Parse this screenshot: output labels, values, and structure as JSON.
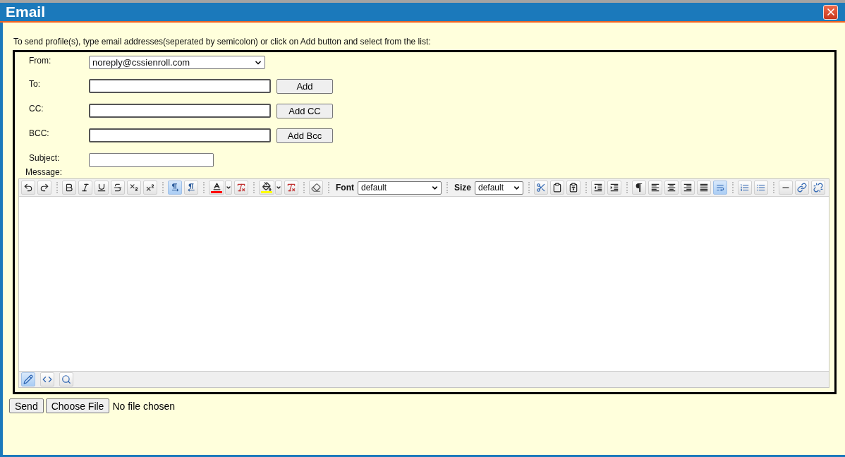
{
  "window": {
    "title": "Email"
  },
  "instructions": "To send profile(s), type email addresses(seperated by semicolon) or click on Add button and select from the list:",
  "form": {
    "from": {
      "label": "From:",
      "value": "noreply@cssienroll.com"
    },
    "recipients": [
      {
        "label": "To:",
        "button": "Add"
      },
      {
        "label": "CC:",
        "button": "Add CC"
      },
      {
        "label": "BCC:",
        "button": "Add Bcc"
      }
    ],
    "subject": {
      "label": "Subject:"
    },
    "message": {
      "label": "Message:"
    }
  },
  "editor": {
    "toolbar": [
      {
        "items": [
          {
            "kind": "button",
            "selected": false
          },
          {
            "kind": "button",
            "selected": false
          }
        ]
      },
      {
        "items": [
          {
            "kind": "button",
            "selected": false
          },
          {
            "kind": "button",
            "selected": false
          },
          {
            "kind": "button",
            "selected": false
          },
          {
            "kind": "button",
            "selected": false
          },
          {
            "kind": "button",
            "selected": false
          },
          {
            "kind": "button",
            "selected": false
          }
        ]
      },
      {
        "items": [
          {
            "kind": "button",
            "selected": true
          },
          {
            "kind": "button",
            "selected": false
          }
        ]
      },
      {
        "items": [
          {
            "kind": "color",
            "selected": false
          },
          {
            "kind": "button",
            "selected": false
          }
        ]
      },
      {
        "items": [
          {
            "kind": "color",
            "selected": false
          },
          {
            "kind": "button",
            "selected": false
          }
        ]
      },
      {
        "items": [
          {
            "kind": "button",
            "selected": false
          }
        ]
      },
      {
        "items": [
          {
            "kind": "select",
            "label": "Font",
            "value": "default"
          }
        ]
      },
      {
        "items": [
          {
            "kind": "select",
            "label": "Size",
            "value": "default"
          }
        ]
      },
      {
        "items": [
          {
            "kind": "button",
            "selected": false
          },
          {
            "kind": "button",
            "selected": false
          },
          {
            "kind": "button",
            "selected": false
          }
        ]
      },
      {
        "items": [
          {
            "kind": "button",
            "selected": false
          },
          {
            "kind": "button",
            "selected": false
          }
        ]
      },
      {
        "items": [
          {
            "kind": "button",
            "selected": false
          },
          {
            "kind": "button",
            "selected": false
          },
          {
            "kind": "button",
            "selected": false
          },
          {
            "kind": "button",
            "selected": false
          },
          {
            "kind": "button",
            "selected": false
          },
          {
            "kind": "button",
            "selected": true
          }
        ]
      },
      {
        "items": [
          {
            "kind": "button",
            "selected": false
          },
          {
            "kind": "button",
            "selected": false
          }
        ]
      },
      {
        "items": [
          {
            "kind": "button",
            "selected": false
          },
          {
            "kind": "button",
            "selected": false
          },
          {
            "kind": "button",
            "selected": false
          }
        ]
      }
    ],
    "modes": [
      {
        "selected": true
      },
      {
        "selected": false
      },
      {
        "selected": false
      }
    ]
  },
  "actions": {
    "send": "Send",
    "file": {
      "button": "Choose File",
      "status": "No file chosen"
    }
  }
}
